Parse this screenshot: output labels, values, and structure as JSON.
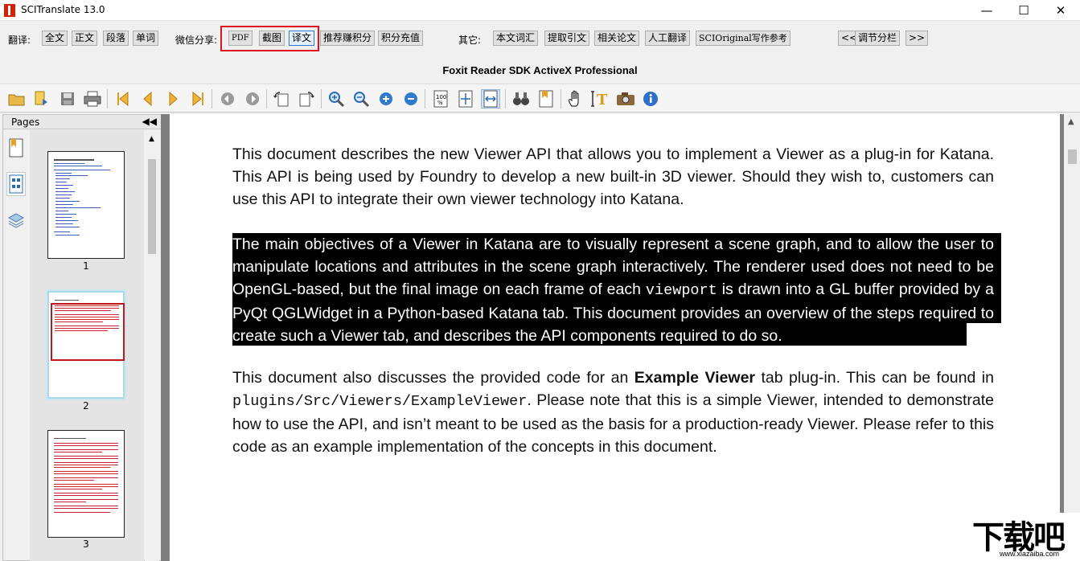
{
  "window": {
    "title": "SCITranslate 13.0",
    "minimize": "—",
    "maximize": "☐",
    "close": "✕"
  },
  "cmdbar": {
    "translate_label": "翻译:",
    "translate_buttons": [
      "全文",
      "正文",
      "段落",
      "单词"
    ],
    "share_label": "微信分享:",
    "share_buttons": [
      "PDF",
      "截图",
      "译文"
    ],
    "points_buttons": [
      "推荐赚积分",
      "积分充值"
    ],
    "other_label": "其它:",
    "other_buttons": [
      "本文词汇",
      "提取引文",
      "相关论文",
      "人工翻译",
      "SCIOriginal写作参考"
    ],
    "nav_prev": "<<",
    "nav_label": "调节分栏",
    "nav_next": ">>"
  },
  "viewer": {
    "title": "Foxit Reader SDK ActiveX Professional"
  },
  "toolbar_icons": [
    "open-icon",
    "open-folder-icon",
    "save-icon",
    "print-icon",
    "first-page-icon",
    "prev-page-icon",
    "next-page-icon",
    "last-page-icon",
    "back-icon",
    "forward-icon",
    "rotate-left-icon",
    "rotate-right-icon",
    "zoom-in-icon",
    "zoom-out-icon",
    "zoom-in-small-icon",
    "zoom-out-small-icon",
    "actual-size-icon",
    "fit-page-icon",
    "fit-width-icon",
    "find-icon",
    "bookmark-icon",
    "hand-tool-icon",
    "text-select-icon",
    "snapshot-icon",
    "info-icon"
  ],
  "sidebar": {
    "title": "Pages",
    "collapse": "◀◀",
    "thumbnails": [
      {
        "num": "1"
      },
      {
        "num": "2"
      },
      {
        "num": "3"
      }
    ]
  },
  "document": {
    "p1": "This document describes the new Viewer API that allows you to implement a Viewer as a plug-in for Katana. This API is being used by Foundry to develop a new built-in 3D viewer. Should they wish to, customers can use this API to integrate their own viewer technology into Katana.",
    "p2_a": "The main objectives of a Viewer in Katana are to visually represent a scene graph, and to allow the user to manipulate locations and attributes in the scene graph interactively. The renderer used does not need to be OpenGL-based, but the final image on each frame of each ",
    "p2_code": "viewport",
    "p2_b": " is drawn into a GL buffer provided by a PyQt QGLWidget in a Python-based Katana tab. This document provides an overview of the steps required to create such a Viewer tab, and describes the API components required to do so.",
    "p3_a": "This document also discusses the provided code for an ",
    "p3_bold": "Example Viewer",
    "p3_b": " tab plug-in. This can be found in ",
    "p3_code": "plugins/Src/Viewers/ExampleViewer",
    "p3_c": ". Please note that this is a simple Viewer, intended to demonstrate how to use the API, and isn’t meant to be used as the basis for a production-ready Viewer. Please refer to this code as an example implementation of the concepts in this document."
  },
  "watermark": {
    "text": "下载吧",
    "url": "www.xiazaiba.com"
  },
  "colors": {
    "highlight_box": "#e0141e",
    "selection": "#000000",
    "accent": "#2b7bd6"
  }
}
